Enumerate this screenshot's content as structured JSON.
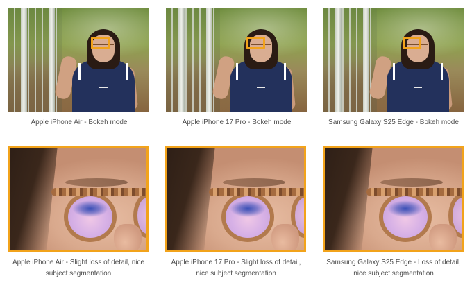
{
  "top_row": [
    {
      "caption": "Apple iPhone Air - Bokeh mode"
    },
    {
      "caption": "Apple iPhone 17 Pro - Bokeh mode"
    },
    {
      "caption": "Samsung Galaxy S25 Edge - Bokeh mode"
    }
  ],
  "bottom_row": [
    {
      "caption_line1": "Apple iPhone Air - Slight loss of detail, nice",
      "caption_line2": "subject segmentation"
    },
    {
      "caption_line1": "Apple iPhone 17 Pro - Slight loss of detail,",
      "caption_line2": "nice subject segmentation"
    },
    {
      "caption_line1": "Samsung Galaxy S25 Edge - Loss of detail,",
      "caption_line2": "nice subject segmentation"
    }
  ],
  "colors": {
    "highlight": "#f2a31b",
    "caption_text": "#4f4f4f"
  }
}
